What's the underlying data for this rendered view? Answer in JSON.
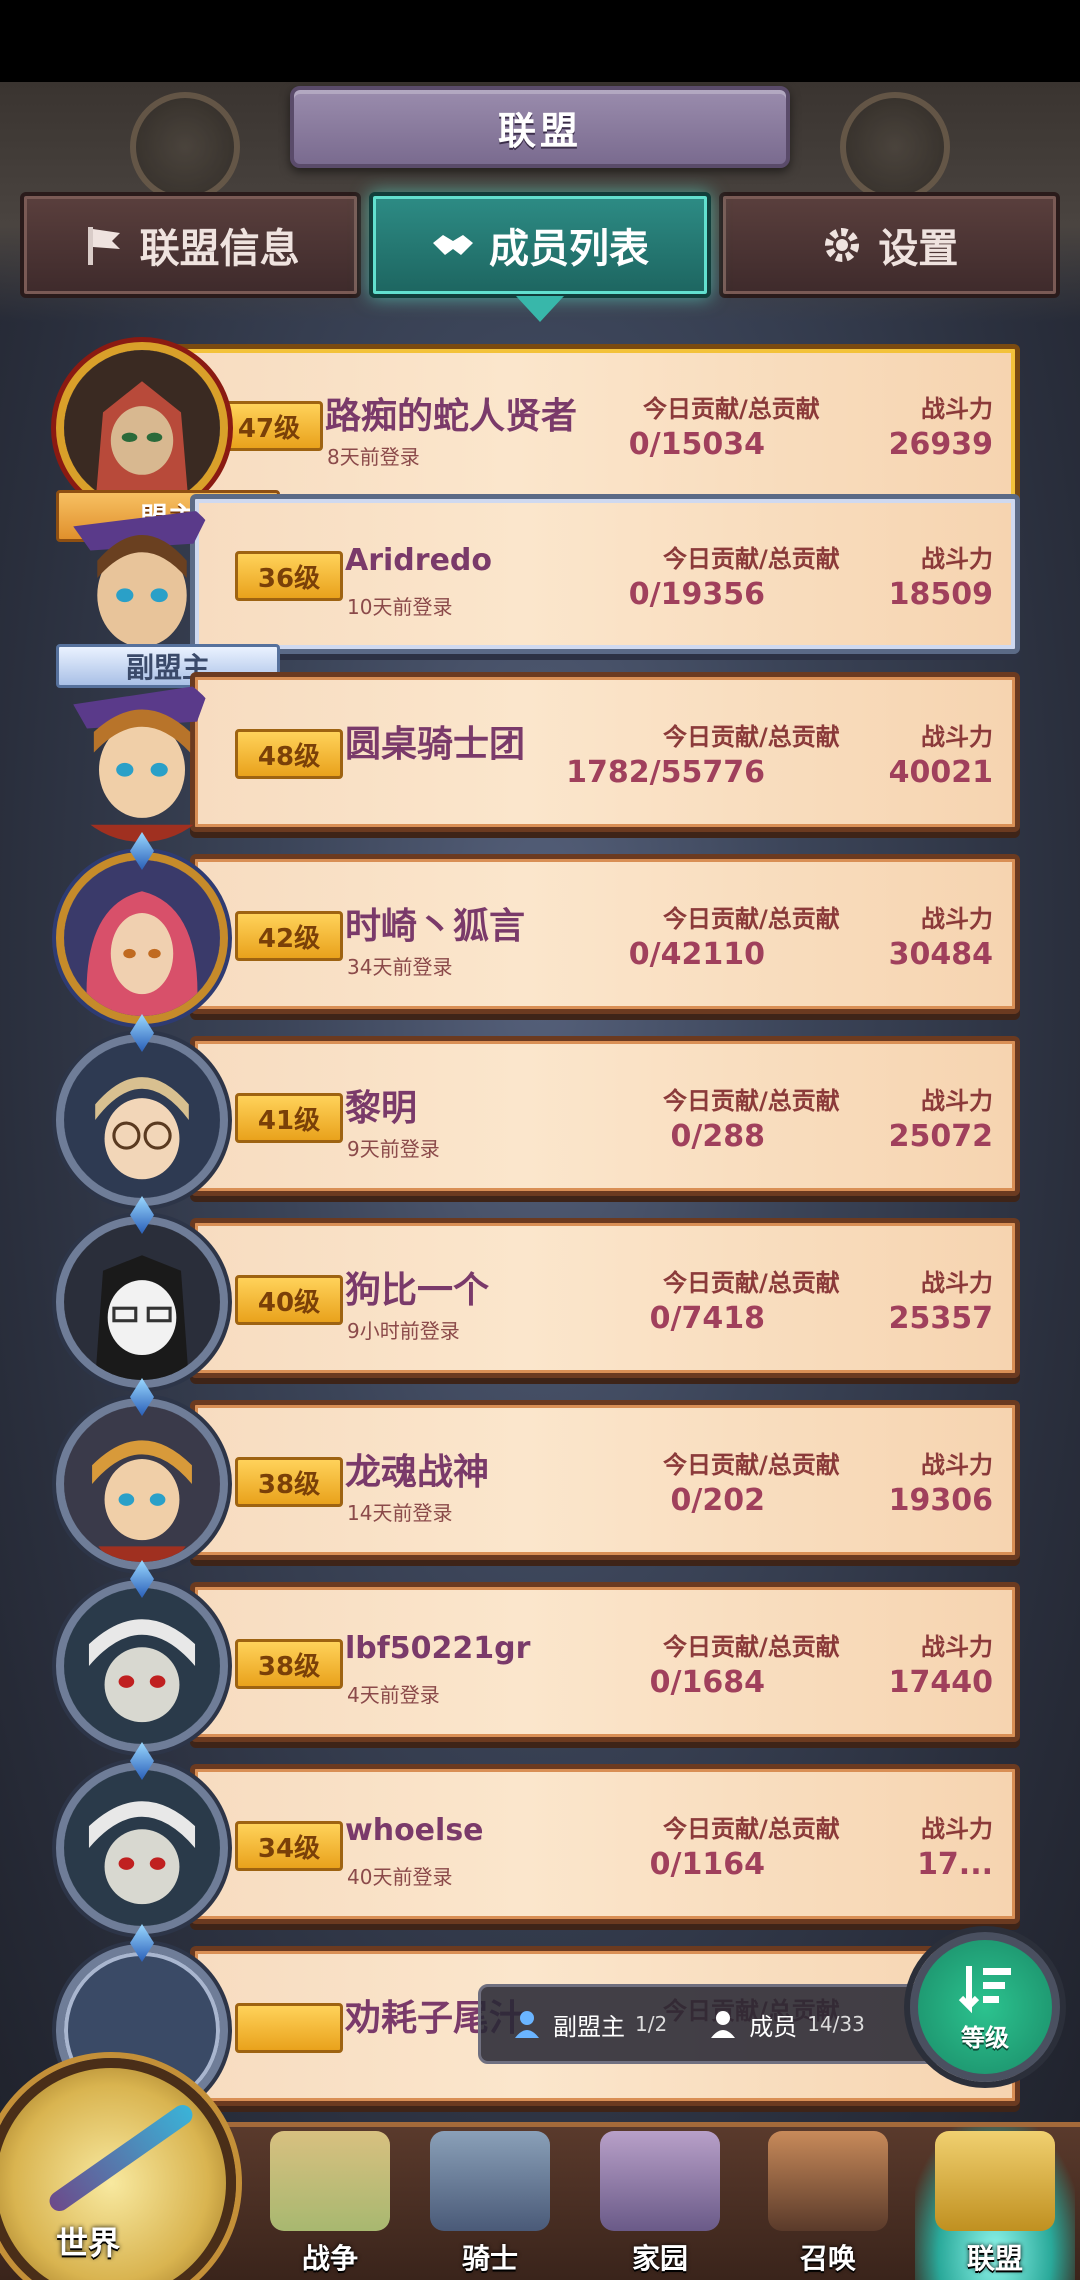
{
  "header": {
    "title": "联盟"
  },
  "tabs": [
    {
      "label": "联盟信息",
      "icon": "flag-icon"
    },
    {
      "label": "成员列表",
      "icon": "handshake-icon",
      "active": true
    },
    {
      "label": "设置",
      "icon": "gear-icon"
    }
  ],
  "columns": {
    "contribution": "今日贡献/总贡献",
    "power": "战斗力"
  },
  "members": [
    {
      "level": "47级",
      "name": "路痴的蛇人贤者",
      "login": "8天前登录",
      "contribution": "0/15034",
      "power": "26939",
      "role": "盟主"
    },
    {
      "level": "36级",
      "name": "Aridredo",
      "login": "10天前登录",
      "contribution": "0/19356",
      "power": "18509",
      "role": "副盟主"
    },
    {
      "level": "48级",
      "name": "圆桌骑士团",
      "login": "",
      "contribution": "1782/55776",
      "power": "40021"
    },
    {
      "level": "42级",
      "name": "时崎丶狐言",
      "login": "34天前登录",
      "contribution": "0/42110",
      "power": "30484"
    },
    {
      "level": "41级",
      "name": "黎明",
      "login": "9天前登录",
      "contribution": "0/288",
      "power": "25072"
    },
    {
      "level": "40级",
      "name": "狗比一个",
      "login": "9小时前登录",
      "contribution": "0/7418",
      "power": "25357"
    },
    {
      "level": "38级",
      "name": "龙魂战神",
      "login": "14天前登录",
      "contribution": "0/202",
      "power": "19306"
    },
    {
      "level": "38级",
      "name": "lbf50221gr",
      "login": "4天前登录",
      "contribution": "0/1684",
      "power": "17440"
    },
    {
      "level": "34级",
      "name": "whoelse",
      "login": "40天前登录",
      "contribution": "0/1164",
      "power": "17..."
    },
    {
      "level": "",
      "name": "劝耗子尾汁",
      "login": "",
      "contribution": "",
      "power": ""
    }
  ],
  "info_panel": {
    "vice_label": "副盟主",
    "vice_count": "1/2",
    "member_label": "成员",
    "member_count": "14/33"
  },
  "sort_button": {
    "label": "等级"
  },
  "nav": {
    "world": "世界",
    "war": "战争",
    "knight": "骑士",
    "home": "家园",
    "summon": "召唤",
    "alliance": "联盟"
  }
}
